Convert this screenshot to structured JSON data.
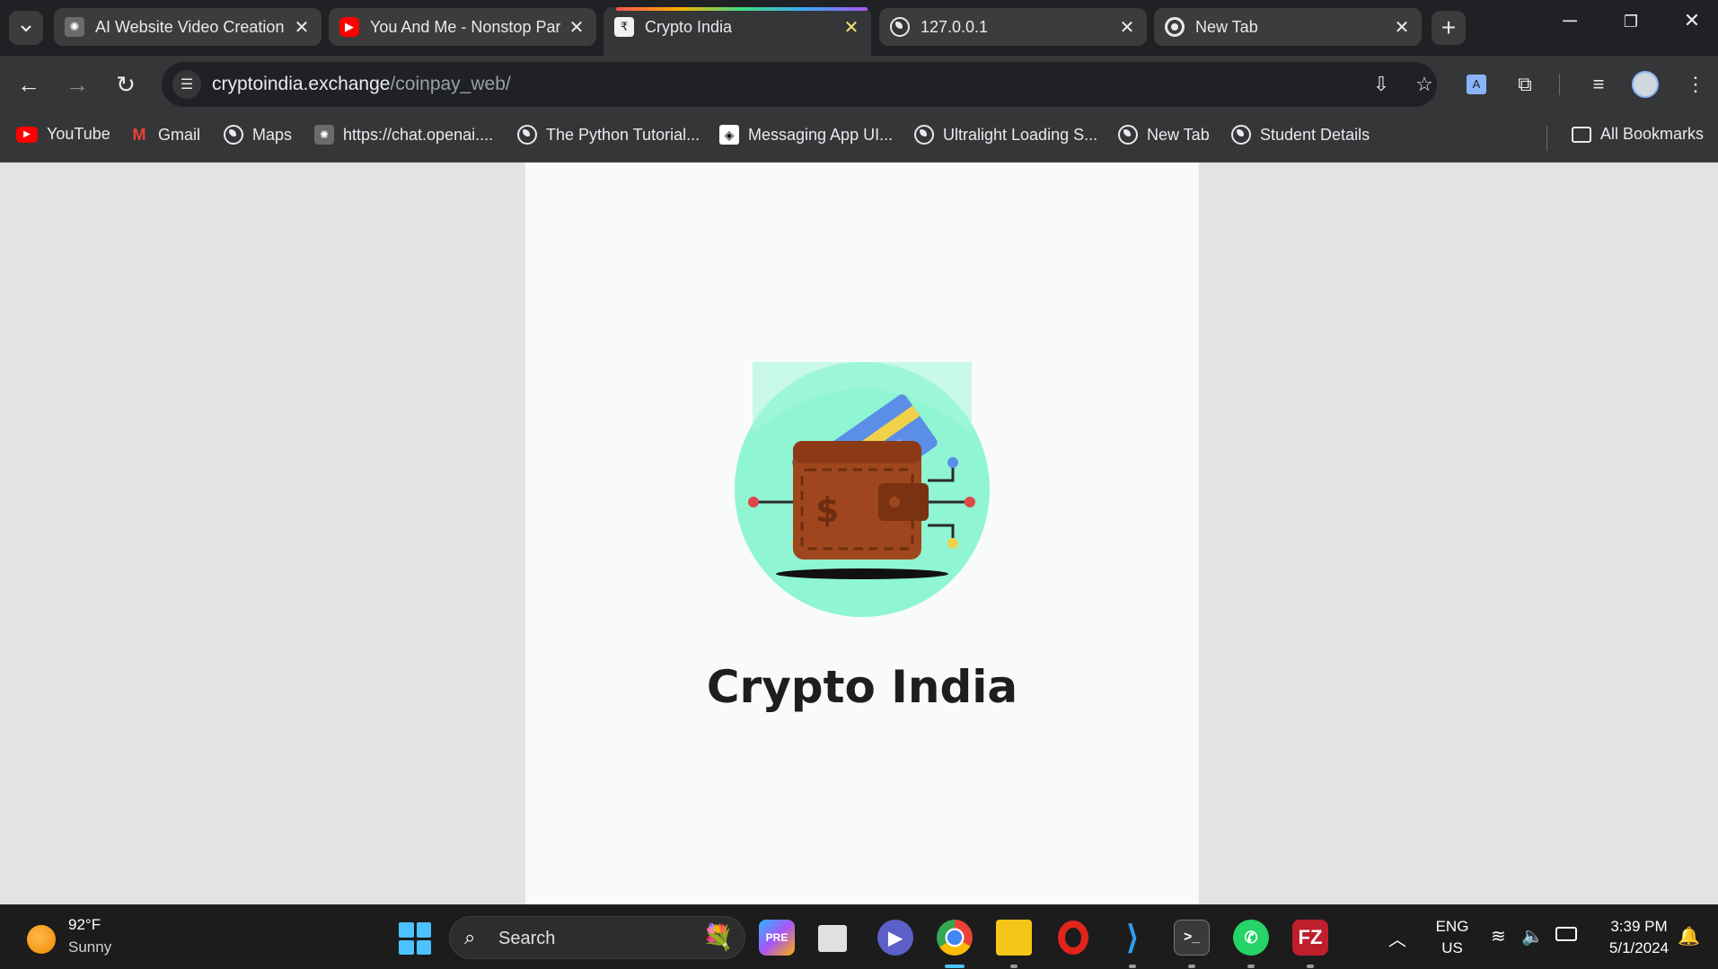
{
  "tabs": [
    {
      "title": "AI Website Video Creation",
      "favicon": "openai-icon",
      "active": false
    },
    {
      "title": "You And Me - Nonstop Party",
      "favicon": "youtube-icon",
      "active": false
    },
    {
      "title": "Crypto India",
      "favicon": "rupee-icon",
      "active": true
    },
    {
      "title": "127.0.0.1",
      "favicon": "globe-icon",
      "active": false
    },
    {
      "title": "New Tab",
      "favicon": "chrome-icon",
      "active": false
    }
  ],
  "toolbar": {
    "url_host": "cryptoindia.exchange",
    "url_path": "/coinpay_web/"
  },
  "bookmarks": [
    {
      "label": "YouTube"
    },
    {
      "label": "Gmail"
    },
    {
      "label": "Maps"
    },
    {
      "label": "https://chat.openai...."
    },
    {
      "label": "The Python Tutorial..."
    },
    {
      "label": "Messaging App UI..."
    },
    {
      "label": "Ultralight Loading S..."
    },
    {
      "label": "New Tab"
    },
    {
      "label": "Student Details"
    }
  ],
  "all_bookmarks_label": "All Bookmarks",
  "page": {
    "brand_title": "Crypto India",
    "colors": {
      "logo_bg": "#8ff5d3",
      "wallet": "#a0461e",
      "card_blue": "#5b8ee6",
      "card_yellow": "#f0d24a"
    }
  },
  "taskbar": {
    "weather_temp": "92°F",
    "weather_condition": "Sunny",
    "search_label": "Search",
    "lang_primary": "ENG",
    "lang_secondary": "US",
    "time": "3:39 PM",
    "date": "5/1/2024"
  }
}
